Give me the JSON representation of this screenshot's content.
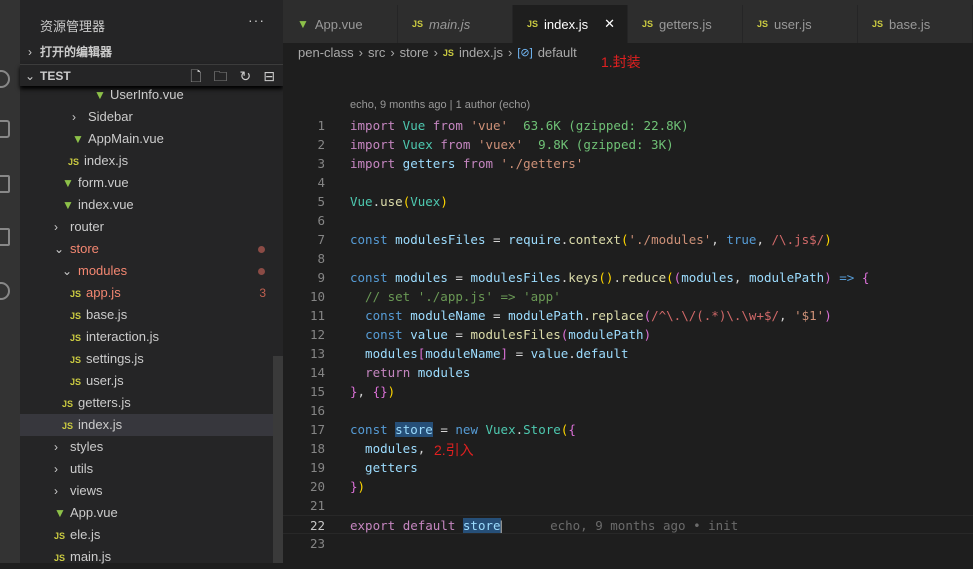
{
  "sidebar": {
    "title": "资源管理器",
    "more": "···",
    "open_editors": "打开的编辑器",
    "workspace": "TEST",
    "actions": [
      "new-file-icon",
      "new-folder-icon",
      "refresh-icon",
      "collapse-icon"
    ],
    "items": [
      {
        "label": "UserInfo.vue",
        "type": "vue",
        "indent": 74
      },
      {
        "label": "Sidebar",
        "type": "folder",
        "indent": 52
      },
      {
        "label": "AppMain.vue",
        "type": "vue",
        "indent": 52
      },
      {
        "label": "index.js",
        "type": "js",
        "indent": 48
      },
      {
        "label": "form.vue",
        "type": "vue",
        "indent": 42
      },
      {
        "label": "index.vue",
        "type": "vue",
        "indent": 42
      },
      {
        "label": "router",
        "type": "folder",
        "indent": 34
      },
      {
        "label": "store",
        "type": "folder-open",
        "indent": 34,
        "modified": true
      },
      {
        "label": "modules",
        "type": "folder-open",
        "indent": 42,
        "modified": true
      },
      {
        "label": "app.js",
        "type": "js",
        "indent": 50,
        "modified": true,
        "count": "3"
      },
      {
        "label": "base.js",
        "type": "js",
        "indent": 50
      },
      {
        "label": "interaction.js",
        "type": "js",
        "indent": 50
      },
      {
        "label": "settings.js",
        "type": "js",
        "indent": 50
      },
      {
        "label": "user.js",
        "type": "js",
        "indent": 50
      },
      {
        "label": "getters.js",
        "type": "js",
        "indent": 42
      },
      {
        "label": "index.js",
        "type": "js",
        "indent": 42,
        "selected": true
      },
      {
        "label": "styles",
        "type": "folder",
        "indent": 34
      },
      {
        "label": "utils",
        "type": "folder",
        "indent": 34
      },
      {
        "label": "views",
        "type": "folder",
        "indent": 34
      },
      {
        "label": "App.vue",
        "type": "vue",
        "indent": 34
      },
      {
        "label": "ele.js",
        "type": "js",
        "indent": 34
      },
      {
        "label": "main.js",
        "type": "js",
        "indent": 34
      }
    ]
  },
  "tabs": [
    {
      "label": "App.vue",
      "type": "vue"
    },
    {
      "label": "main.js",
      "type": "js",
      "italic": true
    },
    {
      "label": "index.js",
      "type": "js",
      "active": true
    },
    {
      "label": "getters.js",
      "type": "js"
    },
    {
      "label": "user.js",
      "type": "js"
    },
    {
      "label": "base.js",
      "type": "js"
    }
  ],
  "breadcrumb": [
    "pen-class",
    "src",
    "store",
    "index.js",
    "default"
  ],
  "annotations": {
    "a1": "1.封装",
    "a2": "2.引入"
  },
  "codelens": "echo, 9 months ago | 1 author (echo)",
  "blame": "echo, 9 months ago • init",
  "code": [
    [
      [
        "import",
        "k"
      ],
      [
        " Vue ",
        "t"
      ],
      [
        "from",
        "k"
      ],
      [
        " ",
        "p"
      ],
      [
        "'vue'",
        "s"
      ],
      [
        "  63.6K (gzipped: 22.8K)",
        "h"
      ]
    ],
    [
      [
        "import",
        "k"
      ],
      [
        " Vuex ",
        "t"
      ],
      [
        "from",
        "k"
      ],
      [
        " ",
        "p"
      ],
      [
        "'vuex'",
        "s"
      ],
      [
        "  9.8K (gzipped: 3K)",
        "h"
      ]
    ],
    [
      [
        "import",
        "k"
      ],
      [
        " getters ",
        "v"
      ],
      [
        "from",
        "k"
      ],
      [
        " ",
        "p"
      ],
      [
        "'./getters'",
        "s"
      ]
    ],
    [],
    [
      [
        "Vue",
        "t"
      ],
      [
        ".",
        "p"
      ],
      [
        "use",
        "f"
      ],
      [
        "(",
        "y"
      ],
      [
        "Vuex",
        "t"
      ],
      [
        ")",
        "y"
      ]
    ],
    [],
    [
      [
        "const",
        "b"
      ],
      [
        " modulesFiles ",
        "v"
      ],
      [
        "= ",
        "p"
      ],
      [
        "require",
        "v"
      ],
      [
        ".",
        "p"
      ],
      [
        "context",
        "f"
      ],
      [
        "(",
        "y"
      ],
      [
        "'./modules'",
        "s"
      ],
      [
        ", ",
        "p"
      ],
      [
        "true",
        "b"
      ],
      [
        ", ",
        "p"
      ],
      [
        "/\\.js$/",
        "r"
      ],
      [
        ")",
        "y"
      ]
    ],
    [],
    [
      [
        "const",
        "b"
      ],
      [
        " modules ",
        "v"
      ],
      [
        "= ",
        "p"
      ],
      [
        "modulesFiles",
        "v"
      ],
      [
        ".",
        "p"
      ],
      [
        "keys",
        "f"
      ],
      [
        "()",
        "y"
      ],
      [
        ".",
        "p"
      ],
      [
        "reduce",
        "f"
      ],
      [
        "(",
        "y"
      ],
      [
        "(",
        "m"
      ],
      [
        "modules",
        "v"
      ],
      [
        ", ",
        "p"
      ],
      [
        "modulePath",
        "v"
      ],
      [
        ")",
        "m"
      ],
      [
        " => ",
        "b"
      ],
      [
        "{",
        "m"
      ]
    ],
    [
      [
        "  // set './app.js' => 'app'",
        "c"
      ]
    ],
    [
      [
        "  ",
        "p"
      ],
      [
        "const",
        "b"
      ],
      [
        " moduleName ",
        "v"
      ],
      [
        "= ",
        "p"
      ],
      [
        "modulePath",
        "v"
      ],
      [
        ".",
        "p"
      ],
      [
        "replace",
        "f"
      ],
      [
        "(",
        "m"
      ],
      [
        "/^\\.\\/(.*)\\.\\w+$/",
        "r"
      ],
      [
        ", ",
        "p"
      ],
      [
        "'$1'",
        "s"
      ],
      [
        ")",
        "m"
      ]
    ],
    [
      [
        "  ",
        "p"
      ],
      [
        "const",
        "b"
      ],
      [
        " value ",
        "v"
      ],
      [
        "= ",
        "p"
      ],
      [
        "modulesFiles",
        "f"
      ],
      [
        "(",
        "m"
      ],
      [
        "modulePath",
        "v"
      ],
      [
        ")",
        "m"
      ]
    ],
    [
      [
        "  modules",
        "v"
      ],
      [
        "[",
        "m"
      ],
      [
        "moduleName",
        "v"
      ],
      [
        "]",
        "m"
      ],
      [
        " = ",
        "p"
      ],
      [
        "value",
        "v"
      ],
      [
        ".",
        "p"
      ],
      [
        "default",
        "v"
      ]
    ],
    [
      [
        "  ",
        "p"
      ],
      [
        "return",
        "k"
      ],
      [
        " modules",
        "v"
      ]
    ],
    [
      [
        "}",
        "m"
      ],
      [
        ", ",
        "p"
      ],
      [
        "{}",
        "m"
      ],
      [
        ")",
        "y"
      ]
    ],
    [],
    [
      [
        "const",
        "b"
      ],
      [
        " ",
        "p"
      ],
      [
        "store",
        "hl"
      ],
      [
        " = ",
        "p"
      ],
      [
        "new",
        "b"
      ],
      [
        " Vuex",
        "t"
      ],
      [
        ".",
        "p"
      ],
      [
        "Store",
        "t"
      ],
      [
        "(",
        "y"
      ],
      [
        "{",
        "m"
      ]
    ],
    [
      [
        "  modules",
        "v"
      ],
      [
        ", ",
        "p"
      ]
    ],
    [
      [
        "  getters",
        "v"
      ]
    ],
    [
      [
        "}",
        "m"
      ],
      [
        ")",
        "y"
      ]
    ],
    [],
    [
      [
        "export",
        "k"
      ],
      [
        " ",
        "p"
      ],
      [
        "default",
        "k"
      ],
      [
        " ",
        "p"
      ],
      [
        "store",
        "hl"
      ]
    ],
    []
  ],
  "current_line": 22,
  "colors": {
    "accent_modified": "#f48771",
    "js_icon": "#cbcb41",
    "vue_icon": "#8dc149",
    "annotation": "#e02020"
  }
}
